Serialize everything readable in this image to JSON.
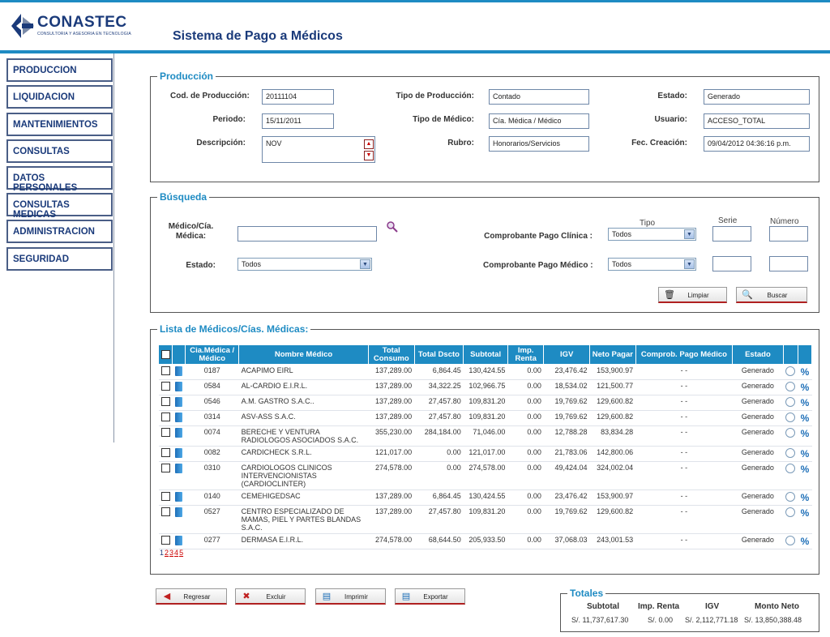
{
  "header": {
    "logo_name": "CONASTEC",
    "logo_sub": "CONSULTORIA Y ASESORIA EN TECNOLOGIA",
    "app_title": "Sistema de Pago a Médicos",
    "brand_color": "#1e8bc3"
  },
  "sidebar": {
    "items": [
      {
        "label": "PRODUCCION"
      },
      {
        "label": "LIQUIDACION"
      },
      {
        "label": "MANTENIMIENTOS"
      },
      {
        "label": "CONSULTAS"
      },
      {
        "label": "DATOS PERSONALES"
      },
      {
        "label": "CONSULTAS MEDICAS"
      },
      {
        "label": "ADMINISTRACION"
      },
      {
        "label": "SEGURIDAD"
      }
    ]
  },
  "produccion": {
    "legend": "Producción",
    "cod_label": "Cod. de Producción:",
    "cod_value": "20111104",
    "periodo_label": "Periodo:",
    "periodo_value": "15/11/2011",
    "descripcion_label": "Descripción:",
    "descripcion_value": "NOV",
    "tipo_prod_label": "Tipo de Producción:",
    "tipo_prod_value": "Contado",
    "tipo_med_label": "Tipo de Médico:",
    "tipo_med_value": "Cía. Médica / Médico",
    "rubro_label": "Rubro:",
    "rubro_value": "Honorarios/Servicios",
    "estado_label": "Estado:",
    "estado_value": "Generado",
    "usuario_label": "Usuario:",
    "usuario_value": "ACCESO_TOTAL",
    "fec_label": "Fec. Creación:",
    "fec_value": "09/04/2012 04:36:16 p.m."
  },
  "busqueda": {
    "legend": "Búsqueda",
    "medico_label_1": "Médico/Cía.",
    "medico_label_2": "Médica:",
    "medico_value": "",
    "estado_label": "Estado:",
    "estado_value": "Todos",
    "tipo_head": "Tipo",
    "serie_head": "Serie",
    "numero_head": "Número",
    "comp_clinica_label": "Comprobante Pago Clínica :",
    "comp_clinica_value": "Todos",
    "comp_medico_label": "Comprobante Pago Médico :",
    "comp_medico_value": "Todos",
    "limpiar_label": "Limpiar",
    "buscar_label": "Buscar"
  },
  "lista": {
    "legend": "Lista de Médicos/Cías. Médicas:",
    "columns": [
      "Cia.Médica / Médico",
      "Nombre Médico",
      "Total Consumo",
      "Total Dscto",
      "Subtotal",
      "Imp. Renta",
      "IGV",
      "Neto Pagar",
      "Comprob. Pago Médico",
      "Estado"
    ],
    "rows": [
      {
        "code": "0187",
        "name": "ACAPIMO EIRL",
        "consumo": "137,289.00",
        "dscto": "6,864.45",
        "subtotal": "130,424.55",
        "renta": "0.00",
        "igv": "23,476.42",
        "neto": "153,900.97",
        "comprob": "- -",
        "estado": "Generado"
      },
      {
        "code": "0584",
        "name": "AL-CARDIO E.I.R.L.",
        "consumo": "137,289.00",
        "dscto": "34,322.25",
        "subtotal": "102,966.75",
        "renta": "0.00",
        "igv": "18,534.02",
        "neto": "121,500.77",
        "comprob": "- -",
        "estado": "Generado"
      },
      {
        "code": "0546",
        "name": "A.M. GASTRO S.A.C..",
        "consumo": "137,289.00",
        "dscto": "27,457.80",
        "subtotal": "109,831.20",
        "renta": "0.00",
        "igv": "19,769.62",
        "neto": "129,600.82",
        "comprob": "- -",
        "estado": "Generado"
      },
      {
        "code": "0314",
        "name": "ASV-ASS S.A.C.",
        "consumo": "137,289.00",
        "dscto": "27,457.80",
        "subtotal": "109,831.20",
        "renta": "0.00",
        "igv": "19,769.62",
        "neto": "129,600.82",
        "comprob": "- -",
        "estado": "Generado"
      },
      {
        "code": "0074",
        "name": "BERECHE Y VENTURA RADIOLOGOS ASOCIADOS S.A.C.",
        "consumo": "355,230.00",
        "dscto": "284,184.00",
        "subtotal": "71,046.00",
        "renta": "0.00",
        "igv": "12,788.28",
        "neto": "83,834.28",
        "comprob": "- -",
        "estado": "Generado"
      },
      {
        "code": "0082",
        "name": "CARDICHECK S.R.L.",
        "consumo": "121,017.00",
        "dscto": "0.00",
        "subtotal": "121,017.00",
        "renta": "0.00",
        "igv": "21,783.06",
        "neto": "142,800.06",
        "comprob": "- -",
        "estado": "Generado"
      },
      {
        "code": "0310",
        "name": "CARDIOLOGOS CLINICOS INTERVENCIONISTAS (CARDIOCLINTER)",
        "consumo": "274,578.00",
        "dscto": "0.00",
        "subtotal": "274,578.00",
        "renta": "0.00",
        "igv": "49,424.04",
        "neto": "324,002.04",
        "comprob": "- -",
        "estado": "Generado"
      },
      {
        "code": "0140",
        "name": "CEMEHIGEDSAC",
        "consumo": "137,289.00",
        "dscto": "6,864.45",
        "subtotal": "130,424.55",
        "renta": "0.00",
        "igv": "23,476.42",
        "neto": "153,900.97",
        "comprob": "- -",
        "estado": "Generado"
      },
      {
        "code": "0527",
        "name": "CENTRO ESPECIALIZADO DE MAMAS, PIEL Y PARTES BLANDAS S.A.C.",
        "consumo": "137,289.00",
        "dscto": "27,457.80",
        "subtotal": "109,831.20",
        "renta": "0.00",
        "igv": "19,769.62",
        "neto": "129,600.82",
        "comprob": "- -",
        "estado": "Generado"
      },
      {
        "code": "0277",
        "name": "DERMASA E.I.R.L.",
        "consumo": "274,578.00",
        "dscto": "68,644.50",
        "subtotal": "205,933.50",
        "renta": "0.00",
        "igv": "37,068.03",
        "neto": "243,001.53",
        "comprob": "- -",
        "estado": "Generado"
      }
    ],
    "pages": [
      "1",
      "2",
      "3",
      "4",
      "5"
    ]
  },
  "actions": {
    "regresar": "Regresar",
    "excluir": "Excluir",
    "imprimir": "Imprimir",
    "exportar": "Exportar"
  },
  "totales": {
    "legend": "Totales",
    "subtotal_h": "Subtotal",
    "renta_h": "Imp. Renta",
    "igv_h": "IGV",
    "neto_h": "Monto Neto",
    "subtotal_v": "S/. 11,737,617.30",
    "renta_v": "S/. 0.00",
    "igv_v": "S/. 2,112,771.18",
    "neto_v": "S/. 13,850,388.48"
  }
}
